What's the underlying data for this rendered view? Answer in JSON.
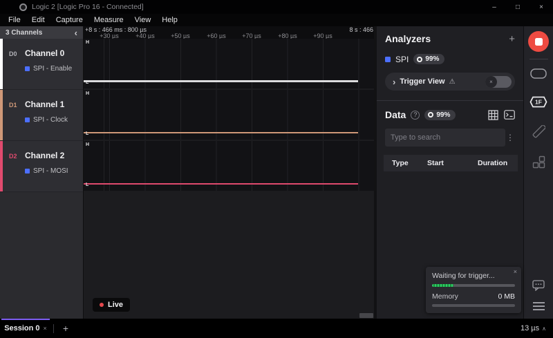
{
  "window": {
    "title": "Logic 2 [Logic Pro 16 - Connected]",
    "minimize": "–",
    "maximize": "□",
    "close": "×"
  },
  "menu": {
    "items": [
      "File",
      "Edit",
      "Capture",
      "Measure",
      "View",
      "Help"
    ]
  },
  "channels_panel": {
    "header": "3 Channels",
    "collapse_icon": "‹",
    "channels": [
      {
        "id": "D0",
        "name": "Channel 0",
        "analyzer": "SPI - Enable",
        "color": "#ffffff",
        "state": "low"
      },
      {
        "id": "D1",
        "name": "Channel 1",
        "analyzer": "SPI - Clock",
        "color": "#cf9878",
        "state": "low"
      },
      {
        "id": "D2",
        "name": "Channel 2",
        "analyzer": "SPI - MOSI",
        "color": "#e04a6e",
        "state": "low"
      }
    ]
  },
  "timeline": {
    "start_label": "+8 s : 466 ms : 800 µs",
    "end_label": "8 s : 466",
    "ticks": [
      "+30 µs",
      "+40 µs",
      "+50 µs",
      "+60 µs",
      "+70 µs",
      "+80 µs",
      "+90 µs"
    ],
    "marker_high": "H",
    "marker_low": "L"
  },
  "waveform": {
    "live_label": "Live"
  },
  "analyzers": {
    "title": "Analyzers",
    "add_label": "+",
    "spi": {
      "name": "SPI",
      "progress": "99%"
    },
    "trigger_view": {
      "chevron": "›",
      "label": "Trigger View",
      "warning": "⚠"
    }
  },
  "data_panel": {
    "title": "Data",
    "help": "?",
    "progress": "99%",
    "search_placeholder": "Type to search",
    "menu_dots": "⋮",
    "table_headers": [
      "Type",
      "Start",
      "Duration"
    ]
  },
  "status_popup": {
    "message": "Waiting for trigger...",
    "close": "×",
    "trigger_progress_pct": 26,
    "memory_label": "Memory",
    "memory_value": "0 MB",
    "memory_progress_pct": 0
  },
  "icon_sidebar": {
    "hex_label": "1F"
  },
  "bottom_bar": {
    "session_label": "Session 0",
    "session_close": "×",
    "add_tab": "+",
    "capture_duration": "13 µs",
    "expand": "∧"
  },
  "colors": {
    "accent_purple": "#7c5cf0",
    "record_red": "#ee4b42",
    "analyzer_blue": "#4c6fff",
    "live_dot": "#e5484d",
    "progress_green": "#2ecc63",
    "ch0": "#ffffff",
    "ch1": "#cf9878",
    "ch2": "#e04a6e"
  }
}
